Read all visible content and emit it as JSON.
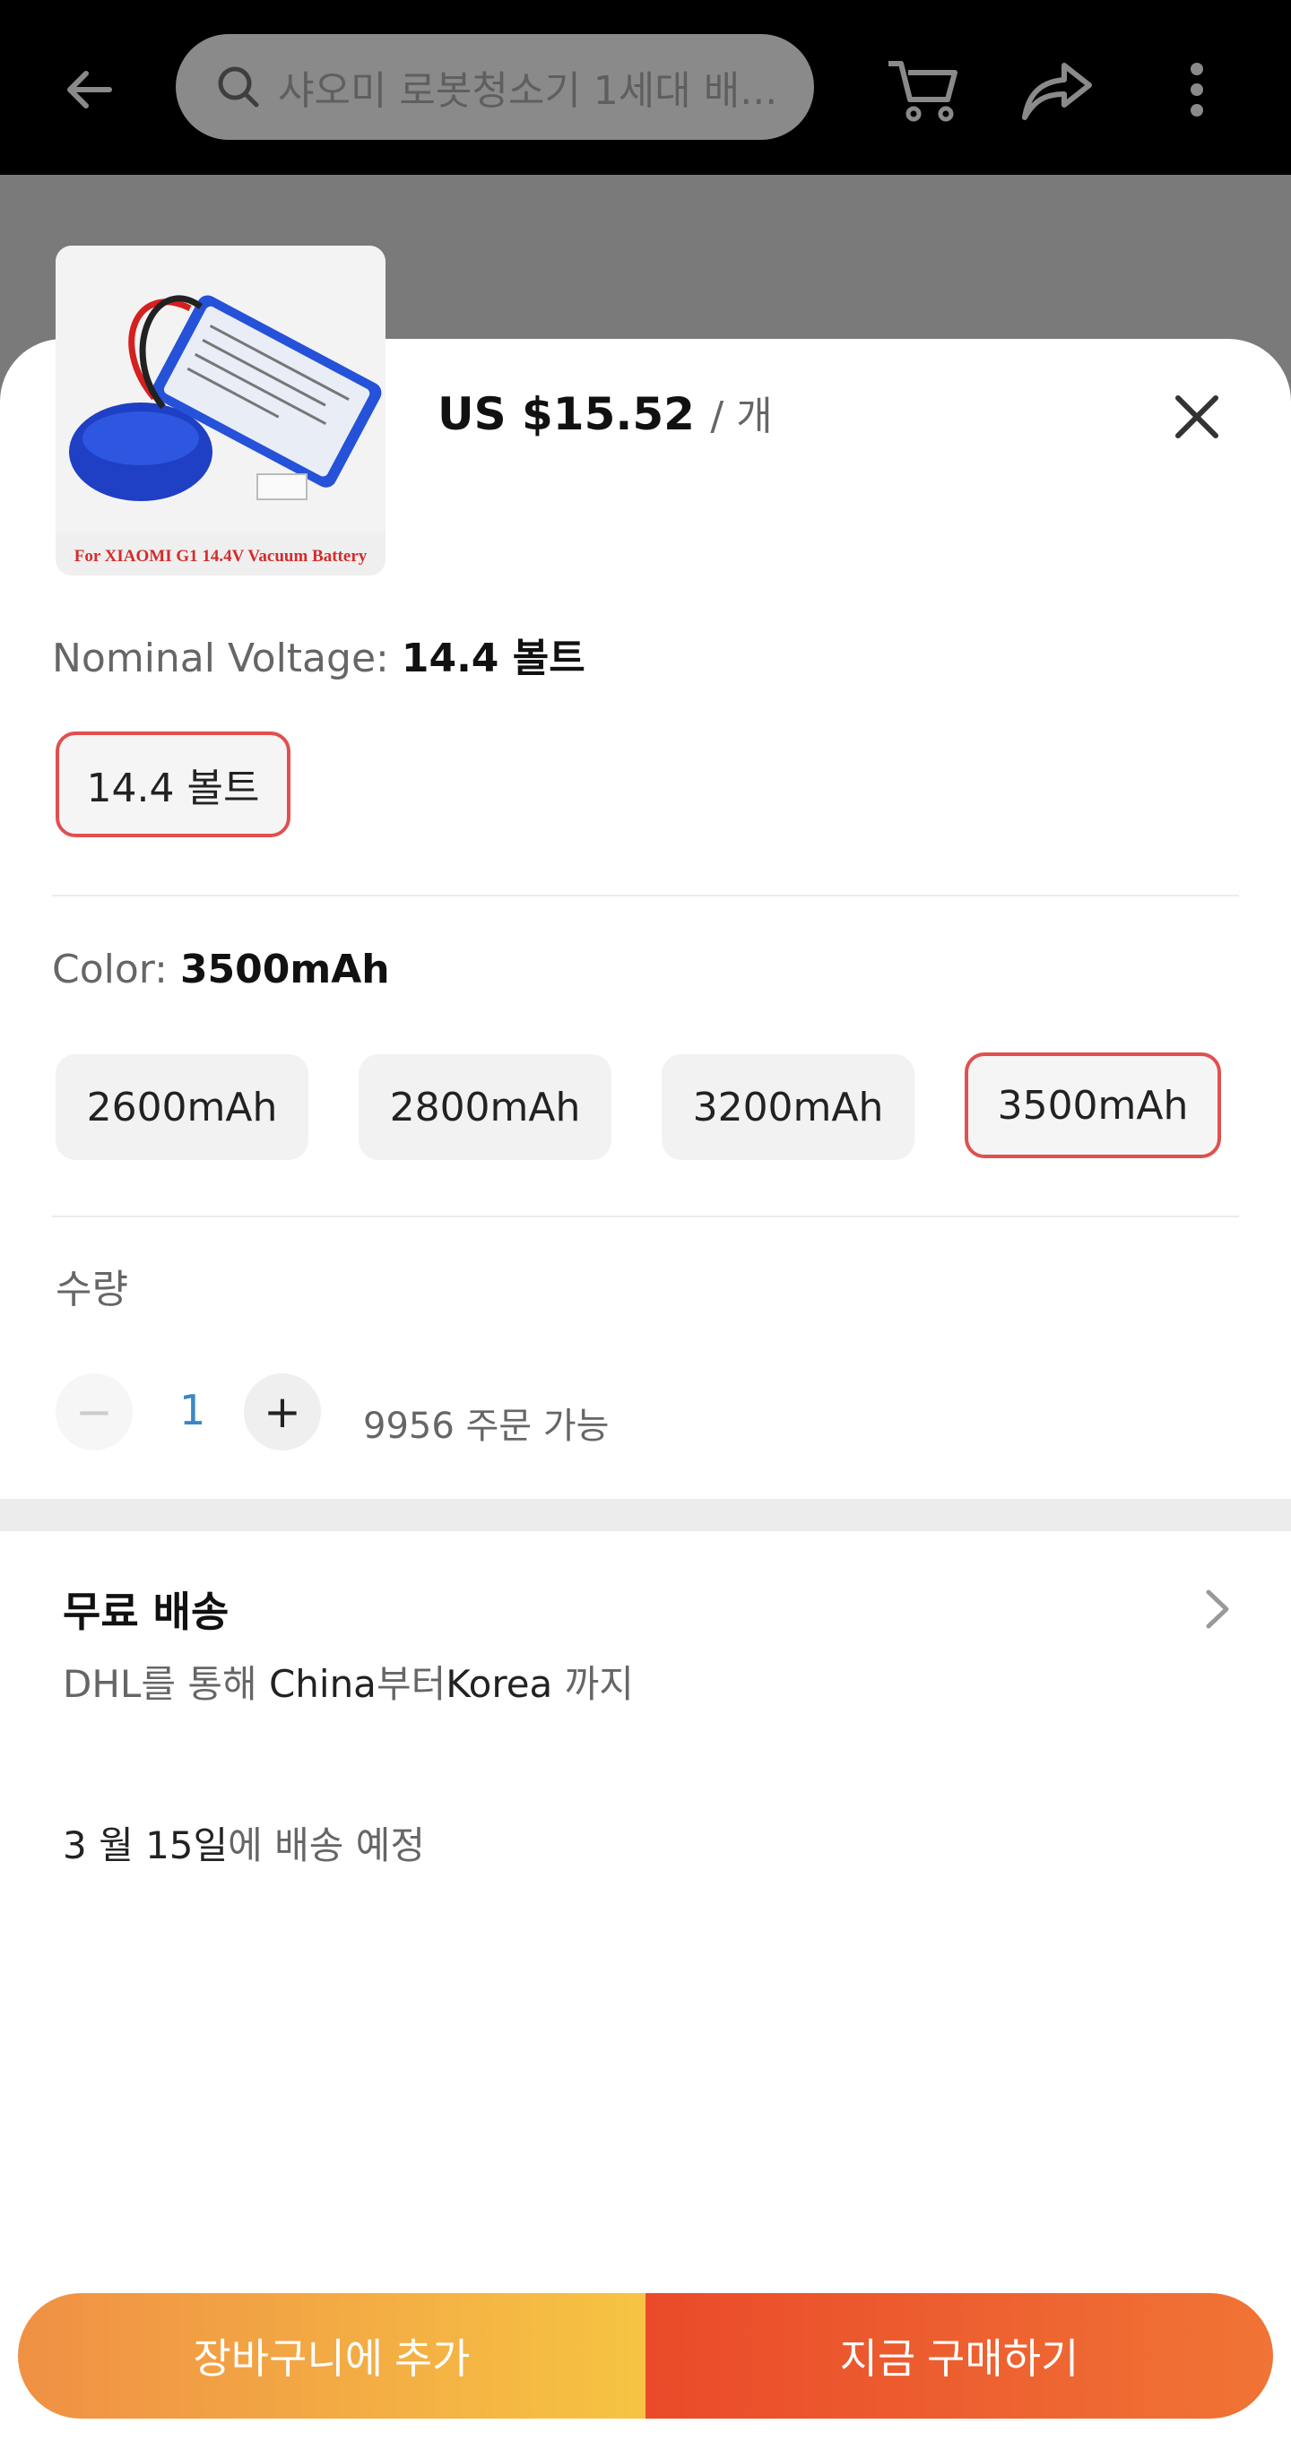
{
  "header": {
    "search_placeholder": "샤오미 로봇청소기 1세대 배...",
    "icons": [
      "back-arrow-icon",
      "search-icon",
      "cart-icon",
      "share-icon",
      "more-icon"
    ]
  },
  "product": {
    "image_caption": "For XIAOMI G1 14.4V Vacuum Battery",
    "price": "US $15.52",
    "price_unit": "/ 개"
  },
  "voltage": {
    "label": "Nominal Voltage:",
    "selected": "14.4 볼트",
    "options": [
      "14.4 볼트"
    ]
  },
  "color": {
    "label": "Color:",
    "selected": "3500mAh",
    "options": [
      "2600mAh",
      "2800mAh",
      "3200mAh",
      "3500mAh"
    ]
  },
  "quantity": {
    "label": "수량",
    "minus": "−",
    "plus": "+",
    "value": "1",
    "available": "9956 주문 가능"
  },
  "shipping": {
    "title": "무료 배송",
    "via_prefix": "DHL를 통해 ",
    "from": "China",
    "from_suffix": "부터",
    "to": "Korea",
    "to_suffix": " 까지",
    "eta_date": "3 월 15일",
    "eta_suffix": "에 배송 예정"
  },
  "actions": {
    "add_to_cart": "장바구니에 추가",
    "buy_now": "지금 구매하기"
  },
  "colors": {
    "accent_red": "#e0504f",
    "cart_gradient": [
      "#f09044",
      "#f6c443"
    ],
    "buy_gradient": [
      "#ea4a2a",
      "#f07435"
    ]
  }
}
